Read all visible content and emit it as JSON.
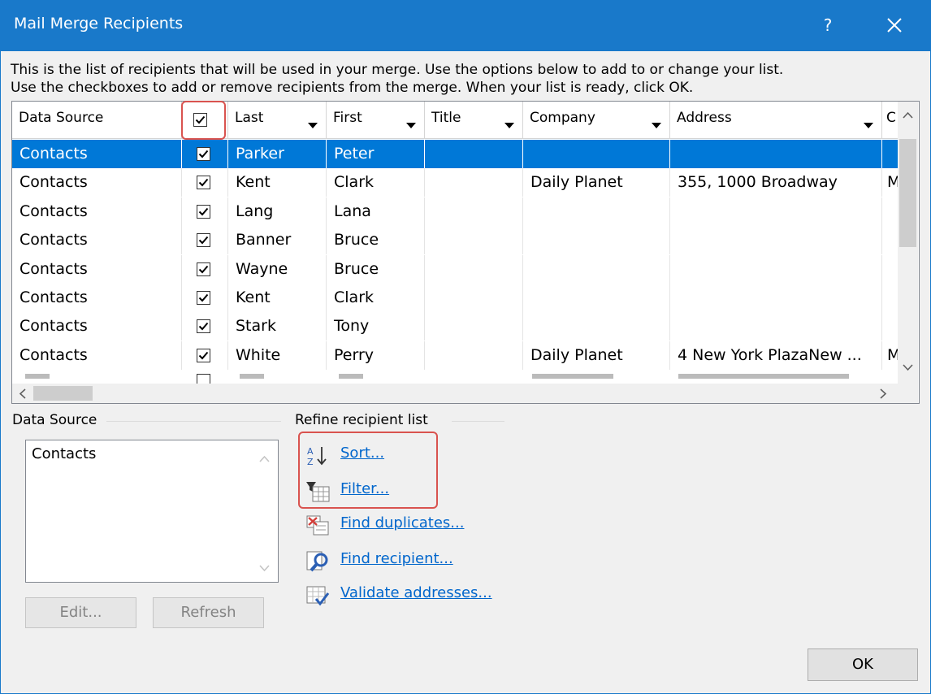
{
  "window": {
    "title": "Mail Merge Recipients",
    "help_label": "?",
    "intro_line1": "This is the list of recipients that will be used in your merge.  Use the options below to add to or change your list.",
    "intro_line2": "Use the checkboxes to add or remove recipients from the merge.  When your list is ready, click OK."
  },
  "table": {
    "columns": [
      {
        "label": "Data Source"
      },
      {
        "label": ""
      },
      {
        "label": "Last"
      },
      {
        "label": "First"
      },
      {
        "label": "Title"
      },
      {
        "label": "Company"
      },
      {
        "label": "Address"
      },
      {
        "label": "C"
      }
    ],
    "rows": [
      {
        "source": "Contacts",
        "checked": true,
        "last": "Parker",
        "first": "Peter",
        "title": "",
        "company": "",
        "address": "",
        "city": "",
        "selected": true
      },
      {
        "source": "Contacts",
        "checked": true,
        "last": "Kent",
        "first": "Clark",
        "title": "",
        "company": "Daily Planet",
        "address": "355, 1000 Broadway",
        "city": "M"
      },
      {
        "source": "Contacts",
        "checked": true,
        "last": "Lang",
        "first": "Lana",
        "title": "",
        "company": "",
        "address": "",
        "city": ""
      },
      {
        "source": "Contacts",
        "checked": true,
        "last": "Banner",
        "first": "Bruce",
        "title": "",
        "company": "",
        "address": "",
        "city": ""
      },
      {
        "source": "Contacts",
        "checked": true,
        "last": "Wayne",
        "first": "Bruce",
        "title": "",
        "company": "",
        "address": "",
        "city": ""
      },
      {
        "source": "Contacts",
        "checked": true,
        "last": "Kent",
        "first": "Clark",
        "title": "",
        "company": "",
        "address": "",
        "city": ""
      },
      {
        "source": "Contacts",
        "checked": true,
        "last": "Stark",
        "first": "Tony",
        "title": "",
        "company": "",
        "address": "",
        "city": ""
      },
      {
        "source": "Contacts",
        "checked": true,
        "last": "White",
        "first": "Perry",
        "title": "",
        "company": "Daily Planet",
        "address": "4 New York PlazaNew ...",
        "city": "M"
      }
    ]
  },
  "data_source": {
    "label": "Data Source",
    "items": [
      "Contacts"
    ],
    "edit_label": "Edit...",
    "refresh_label": "Refresh"
  },
  "refine": {
    "label": "Refine recipient list",
    "sort_label": "Sort...",
    "filter_label": "Filter...",
    "find_duplicates_label": "Find duplicates...",
    "find_recipient_label": "Find recipient...",
    "validate_label": "Validate addresses..."
  },
  "ok_label": "OK",
  "colors": {
    "titlebar": "#1979ca",
    "selection": "#0078d7",
    "link": "#0066cc",
    "highlight": "#d9534f"
  }
}
